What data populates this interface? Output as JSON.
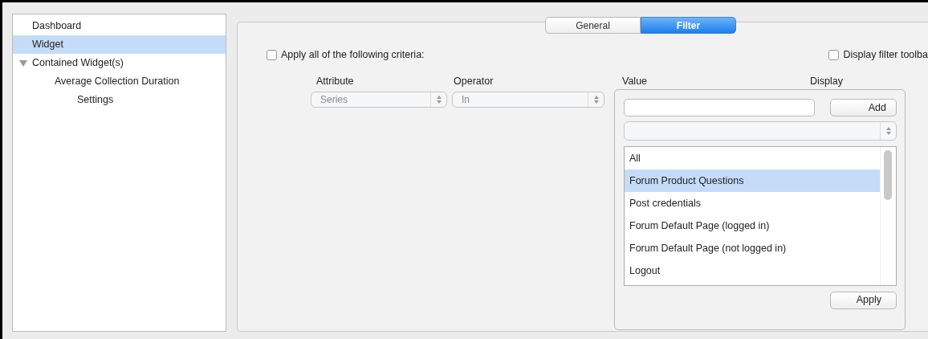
{
  "sidebar": {
    "items": [
      {
        "label": "Dashboard",
        "selected": false
      },
      {
        "label": "Widget",
        "selected": true
      },
      {
        "label": "Contained Widget(s)",
        "selected": false,
        "expanded": true,
        "children": [
          {
            "label": "Average Collection Duration",
            "selected": false,
            "children": [
              {
                "label": "Settings",
                "selected": false
              }
            ]
          }
        ]
      }
    ]
  },
  "tabs": [
    {
      "label": "General",
      "selected": false
    },
    {
      "label": "Filter",
      "selected": true
    }
  ],
  "apply_all": {
    "label": "Apply all of the following criteria:",
    "checked": false
  },
  "display_toolbar": {
    "label": "Display filter toolba",
    "checked": false
  },
  "columns": [
    "Attribute",
    "Operator",
    "Value",
    "Display"
  ],
  "criteria": {
    "attribute": {
      "value": "Series",
      "disabled": true
    },
    "operator": {
      "value": "In",
      "disabled": true
    },
    "value_panel": {
      "add_button": "Add",
      "options": [
        {
          "label": "All",
          "selected": false
        },
        {
          "label": "Forum Product Questions",
          "selected": true
        },
        {
          "label": "Post credentials",
          "selected": false
        },
        {
          "label": "Forum Default Page (logged in)",
          "selected": false
        },
        {
          "label": "Forum Default Page (not logged in)",
          "selected": false
        },
        {
          "label": "Logout",
          "selected": false
        }
      ],
      "apply_button": "Apply"
    }
  }
}
